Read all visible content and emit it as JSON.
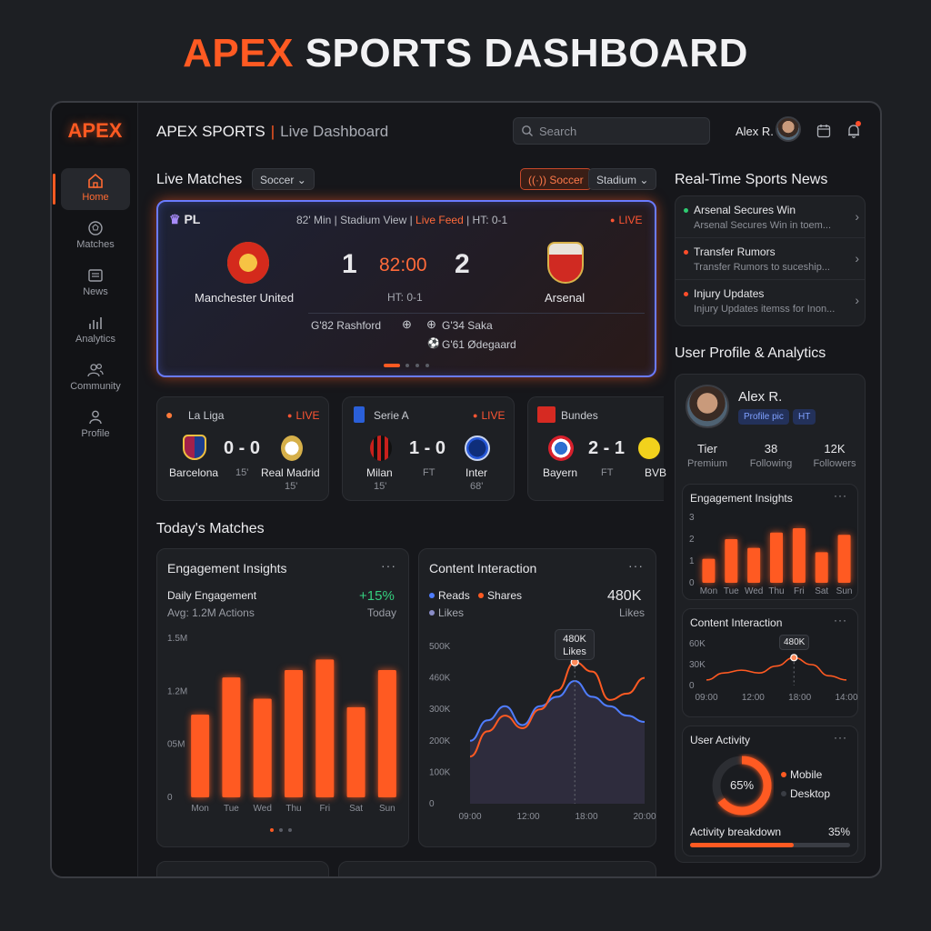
{
  "page_title": {
    "accent": "APEX",
    "rest": "SPORTS DASHBOARD"
  },
  "logo": "APEX",
  "nav": [
    {
      "label": "Home",
      "icon": "home-icon",
      "active": true
    },
    {
      "label": "Matches",
      "icon": "ball-icon"
    },
    {
      "label": "News",
      "icon": "news-icon"
    },
    {
      "label": "Analytics",
      "icon": "analytics-icon"
    },
    {
      "label": "Community",
      "icon": "community-icon"
    },
    {
      "label": "Profile",
      "icon": "profile-icon"
    }
  ],
  "topbar": {
    "title": "APEX SPORTS",
    "subtitle": "Live Dashboard",
    "search_placeholder": "Search",
    "user": "Alex R."
  },
  "live_matches": {
    "heading": "Live Matches",
    "filter": "Soccer",
    "tag": "Soccer",
    "view": "Stadium",
    "featured": {
      "league": "PL",
      "info_a": "82' Min | Stadium View |",
      "info_feed": "Live Feed",
      "info_b": "| HT: 0-1",
      "status": "LIVE",
      "home": "Manchester United",
      "away": "Arsenal",
      "home_score": "1",
      "away_score": "2",
      "clock": "82:00",
      "ht": "HT: 0-1",
      "events": [
        "G'82 Rashford",
        "G'34 Saka",
        "G'61 Ødegaard"
      ]
    },
    "small": [
      {
        "league": "La Liga",
        "status": "LIVE",
        "home": "Barcelona",
        "away": "Real Madrid",
        "score": "0 - 0",
        "min": "15'",
        "min2": "15'"
      },
      {
        "league": "Serie A",
        "status": "LIVE",
        "home": "Milan",
        "away": "Inter",
        "score": "1 - 0",
        "min": "FT",
        "min2": "15'",
        "min3": "68'"
      },
      {
        "league": "Bundes",
        "home": "Bayern",
        "away": "BVB",
        "score": "2 - 1",
        "min": "FT"
      }
    ]
  },
  "todays_matches": "Today's Matches",
  "engagement": {
    "title": "Engagement Insights",
    "label": "Daily Engagement",
    "avg": "Avg: 1.2M Actions",
    "change": "+15%",
    "period": "Today"
  },
  "content": {
    "title": "Content Interaction",
    "legend": [
      "Reads",
      "Shares",
      "Likes"
    ],
    "value": "480K",
    "value_label": "Likes",
    "tooltip_v": "480K",
    "tooltip_l": "Likes"
  },
  "news": {
    "heading": "Real-Time Sports News",
    "items": [
      {
        "title": "Arsenal Secures Win",
        "sub": "Arsenal Secures Win in toem...",
        "color": "#2ecc71"
      },
      {
        "title": "Transfer Rumors",
        "sub": "Transfer Rumors to suceship...",
        "color": "#ff5a22"
      },
      {
        "title": "Injury Updates",
        "sub": "Injury Updates itemss for Inon...",
        "color": "#ff5a22"
      }
    ]
  },
  "profile": {
    "heading": "User Profile & Analytics",
    "name": "Alex R.",
    "tags": [
      "Profile pic",
      "HT"
    ],
    "stats": [
      {
        "value": "Tier",
        "label": "Premium"
      },
      {
        "value": "38",
        "label": "Following"
      },
      {
        "value": "12K",
        "label": "Followers"
      }
    ],
    "eng_title": "Engagement Insights",
    "ci_title": "Content Interaction",
    "ci_tooltip": "480K",
    "activity_title": "User Activity",
    "activity_pct": "65%",
    "activity_legend": [
      "Mobile",
      "Desktop"
    ],
    "breakdown_label": "Activity breakdown",
    "breakdown_pct": "35%"
  },
  "colors": {
    "accent": "#ff5a22",
    "blue": "#4f7dff",
    "live": "#ff5533",
    "positive": "#35d07f"
  },
  "chart_data": [
    {
      "type": "bar",
      "title": "Engagement Insights",
      "categories": [
        "Mon",
        "Tue",
        "Wed",
        "Thu",
        "Fri",
        "Sat",
        "Sun"
      ],
      "values": [
        0.78,
        1.13,
        0.93,
        1.2,
        1.3,
        0.85,
        1.2
      ],
      "y_ticks": [
        "1.5M",
        "1.2M",
        "05M",
        "0"
      ],
      "ylim": [
        0,
        1.5
      ]
    },
    {
      "type": "line",
      "title": "Content Interaction",
      "x_ticks": [
        "09:00",
        "12:00",
        "18:00",
        "20:00"
      ],
      "y_ticks": [
        "500K",
        "460K",
        "300K",
        "200K",
        "100K",
        "0"
      ],
      "ylim": [
        0,
        500
      ],
      "series": [
        {
          "name": "Reads",
          "color": "#4f7dff",
          "values": [
            200,
            265,
            310,
            250,
            310,
            340,
            390,
            340,
            310,
            280,
            260
          ]
        },
        {
          "name": "Shares",
          "color": "#ff5a22",
          "values": [
            150,
            230,
            280,
            240,
            300,
            360,
            450,
            420,
            330,
            350,
            400
          ]
        }
      ]
    },
    {
      "type": "bar",
      "title": "Engagement Insights",
      "categories": [
        "Mon",
        "Tue",
        "Wed",
        "Thu",
        "Fri",
        "Sat",
        "Sun"
      ],
      "values": [
        1.1,
        2.0,
        1.6,
        2.3,
        2.5,
        1.4,
        2.2
      ],
      "y_ticks": [
        "3",
        "2",
        "1",
        "0"
      ],
      "ylim": [
        0,
        3
      ]
    },
    {
      "type": "line",
      "title": "Content Interaction",
      "x_ticks": [
        "09:00",
        "12:00",
        "18:00",
        "14:00"
      ],
      "y_ticks": [
        "60K",
        "30K",
        "0"
      ],
      "ylim": [
        0,
        60
      ],
      "series": [
        {
          "name": "Interaction",
          "color": "#ff5a22",
          "values": [
            8,
            18,
            22,
            18,
            28,
            40,
            30,
            14,
            8
          ]
        }
      ]
    }
  ]
}
